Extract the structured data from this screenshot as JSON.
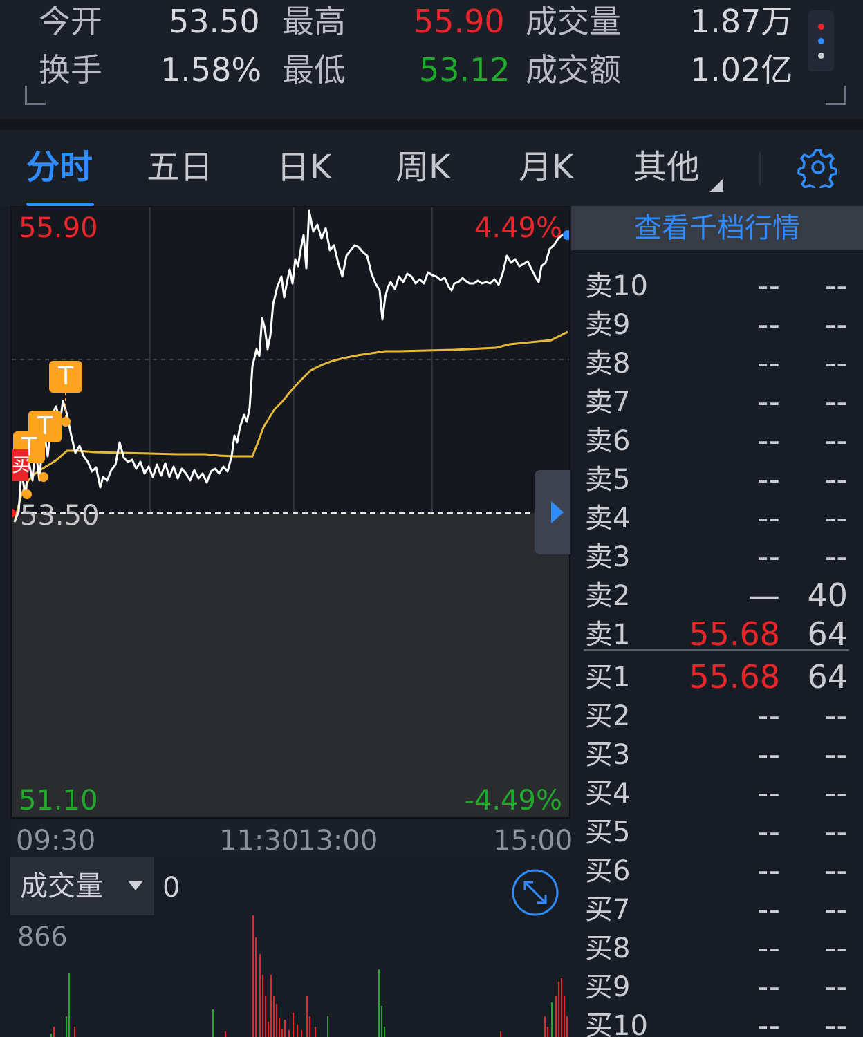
{
  "stats": {
    "open_label": "今开",
    "open_value": "53.50",
    "high_label": "最高",
    "high_value": "55.90",
    "volume_label": "成交量",
    "volume_value": "1.87万",
    "turnover_label": "换手",
    "turnover_value": "1.58%",
    "low_label": "最低",
    "low_value": "53.12",
    "amount_label": "成交额",
    "amount_value": "1.02亿"
  },
  "tabs": [
    "分时",
    "五日",
    "日K",
    "周K",
    "月K",
    "其他"
  ],
  "active_tab": "分时",
  "chart": {
    "top_price": "55.90",
    "top_pct": "4.49%",
    "base_price": "53.50",
    "bottom_price": "51.10",
    "bottom_pct": "-4.49%",
    "markers": [
      "T",
      "T",
      "T"
    ],
    "badge_text": "买",
    "times": [
      "09:30",
      "11:30",
      "13:00",
      "15:00"
    ]
  },
  "volume": {
    "label": "成交量",
    "current_value": "0",
    "max_label": "866"
  },
  "book": {
    "header": "查看千档行情",
    "sells": [
      {
        "name": "卖10",
        "price": "--",
        "qty": "--"
      },
      {
        "name": "卖9",
        "price": "--",
        "qty": "--"
      },
      {
        "name": "卖8",
        "price": "--",
        "qty": "--"
      },
      {
        "name": "卖7",
        "price": "--",
        "qty": "--"
      },
      {
        "name": "卖6",
        "price": "--",
        "qty": "--"
      },
      {
        "name": "卖5",
        "price": "--",
        "qty": "--"
      },
      {
        "name": "卖4",
        "price": "--",
        "qty": "--"
      },
      {
        "name": "卖3",
        "price": "--",
        "qty": "--"
      },
      {
        "name": "卖2",
        "price": "—",
        "qty": "40"
      },
      {
        "name": "卖1",
        "price": "55.68",
        "qty": "64"
      }
    ],
    "buys": [
      {
        "name": "买1",
        "price": "55.68",
        "qty": "64"
      },
      {
        "name": "买2",
        "price": "--",
        "qty": "--"
      },
      {
        "name": "买3",
        "price": "--",
        "qty": "--"
      },
      {
        "name": "买4",
        "price": "--",
        "qty": "--"
      },
      {
        "name": "买5",
        "price": "--",
        "qty": "--"
      },
      {
        "name": "买6",
        "price": "--",
        "qty": "--"
      },
      {
        "name": "买7",
        "price": "--",
        "qty": "--"
      },
      {
        "name": "买8",
        "price": "--",
        "qty": "--"
      },
      {
        "name": "买9",
        "price": "--",
        "qty": "--"
      },
      {
        "name": "买10",
        "price": "--",
        "qty": "--"
      }
    ]
  },
  "colors": {
    "accent": "#2f8cff",
    "up": "#e8262a",
    "down": "#1faa2b",
    "avg_line": "#e6b83a",
    "price_line": "#ffffff",
    "marker": "#ffa41f"
  },
  "icons": [
    "more-menu-icon",
    "settings-gear-icon",
    "expand-arrows-icon",
    "dropdown-triangle-icon",
    "collapse-arrow-icon"
  ]
}
